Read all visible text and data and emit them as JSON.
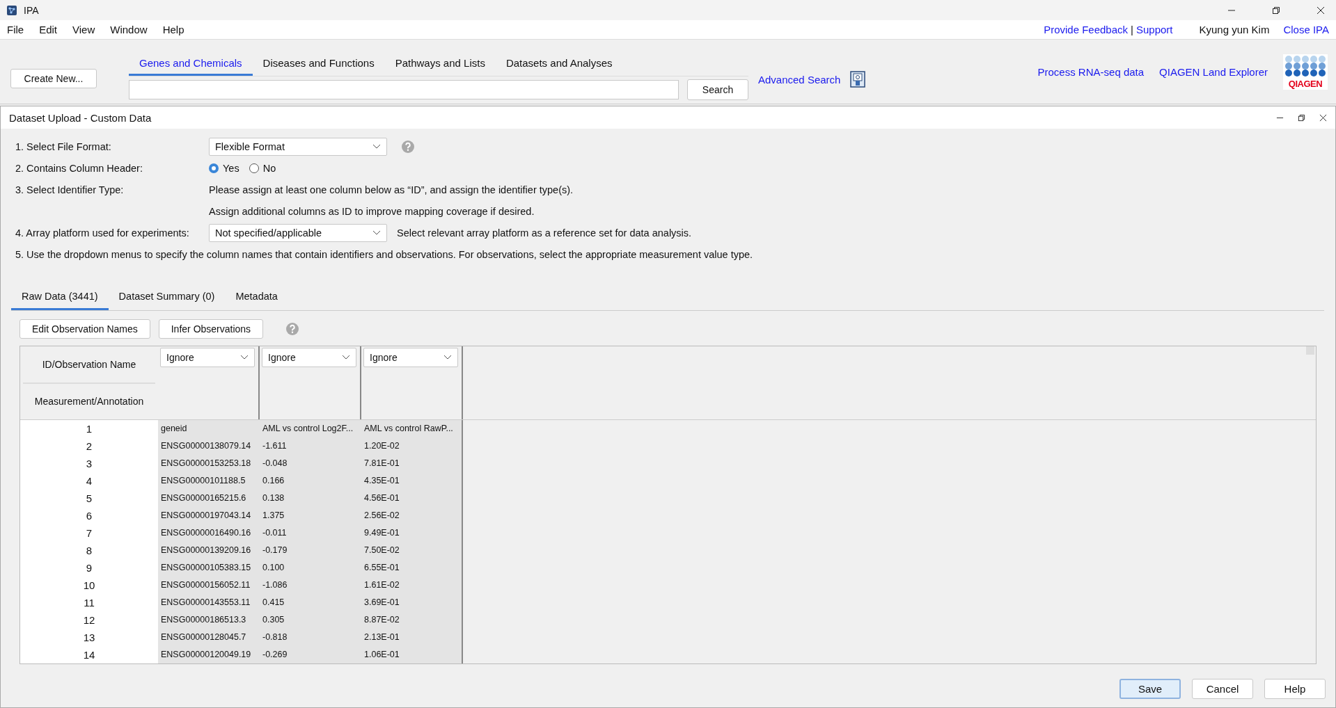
{
  "window": {
    "title": "IPA"
  },
  "menu": [
    "File",
    "Edit",
    "View",
    "Window",
    "Help"
  ],
  "top_links": {
    "feedback": "Provide Feedback",
    "separator": "|",
    "support": "Support",
    "user": "Kyung yun Kim",
    "close": "Close IPA"
  },
  "toolbar": {
    "create_button": "Create New...",
    "tabs": [
      {
        "label": "Genes and Chemicals",
        "selected": true
      },
      {
        "label": "Diseases and Functions",
        "selected": false
      },
      {
        "label": "Pathways and Lists",
        "selected": false
      },
      {
        "label": "Datasets and Analyses",
        "selected": false
      }
    ],
    "search_button": "Search",
    "advanced_search": "Advanced Search",
    "links": [
      "Process RNA-seq data",
      "QIAGEN Land Explorer"
    ],
    "logo": "QIAGEN"
  },
  "dialog": {
    "title": "Dataset Upload - Custom Data",
    "file_format": {
      "label": "1. Select File Format:",
      "value": "Flexible Format"
    },
    "column_header": {
      "label": "2. Contains Column Header:",
      "options": [
        {
          "label": "Yes",
          "selected": true
        },
        {
          "label": "No",
          "selected": false
        }
      ]
    },
    "identifier": {
      "label": "3. Select Identifier Type:",
      "lines": [
        "Please assign at least one column below as “ID”, and assign the identifier type(s).",
        "Assign additional columns as ID to improve mapping coverage if desired."
      ]
    },
    "array_platform": {
      "label": "4. Array platform used for experiments:",
      "value": "Not specified/applicable",
      "hint": "Select relevant array platform as a reference set for data analysis."
    },
    "instruction": "5. Use the dropdown menus to specify the column names that contain identifiers and observations. For observations, select the appropriate measurement value type.",
    "tabs": [
      {
        "label": "Raw Data (3441)",
        "selected": true
      },
      {
        "label": "Dataset Summary (0)",
        "selected": false
      },
      {
        "label": "Metadata",
        "selected": false
      }
    ],
    "actions": [
      "Edit Observation Names",
      "Infer Observations"
    ],
    "table": {
      "row_header_1": "ID/Observation Name",
      "row_header_2": "Measurement/Annotation",
      "column_types": [
        "Ignore",
        "Ignore",
        "Ignore"
      ],
      "rows": [
        [
          "1",
          "geneid",
          "AML vs control Log2F...",
          "AML vs control RawP..."
        ],
        [
          "2",
          "ENSG00000138079.14",
          "-1.611",
          "1.20E-02"
        ],
        [
          "3",
          "ENSG00000153253.18",
          "-0.048",
          "7.81E-01"
        ],
        [
          "4",
          "ENSG00000101188.5",
          "0.166",
          "4.35E-01"
        ],
        [
          "5",
          "ENSG00000165215.6",
          "0.138",
          "4.56E-01"
        ],
        [
          "6",
          "ENSG00000197043.14",
          "1.375",
          "2.56E-02"
        ],
        [
          "7",
          "ENSG00000016490.16",
          "-0.011",
          "9.49E-01"
        ],
        [
          "8",
          "ENSG00000139209.16",
          "-0.179",
          "7.50E-02"
        ],
        [
          "9",
          "ENSG00000105383.15",
          "0.100",
          "6.55E-01"
        ],
        [
          "10",
          "ENSG00000156052.11",
          "-1.086",
          "1.61E-02"
        ],
        [
          "11",
          "ENSG00000143553.11",
          "0.415",
          "3.69E-01"
        ],
        [
          "12",
          "ENSG00000186513.3",
          "0.305",
          "8.87E-02"
        ],
        [
          "13",
          "ENSG00000128045.7",
          "-0.818",
          "2.13E-01"
        ],
        [
          "14",
          "ENSG00000120049.19",
          "-0.269",
          "1.06E-01"
        ]
      ]
    },
    "buttons": [
      {
        "label": "Save",
        "kind": "default"
      },
      {
        "label": "Cancel",
        "kind": "normal"
      },
      {
        "label": "Help",
        "kind": "normal"
      }
    ]
  }
}
